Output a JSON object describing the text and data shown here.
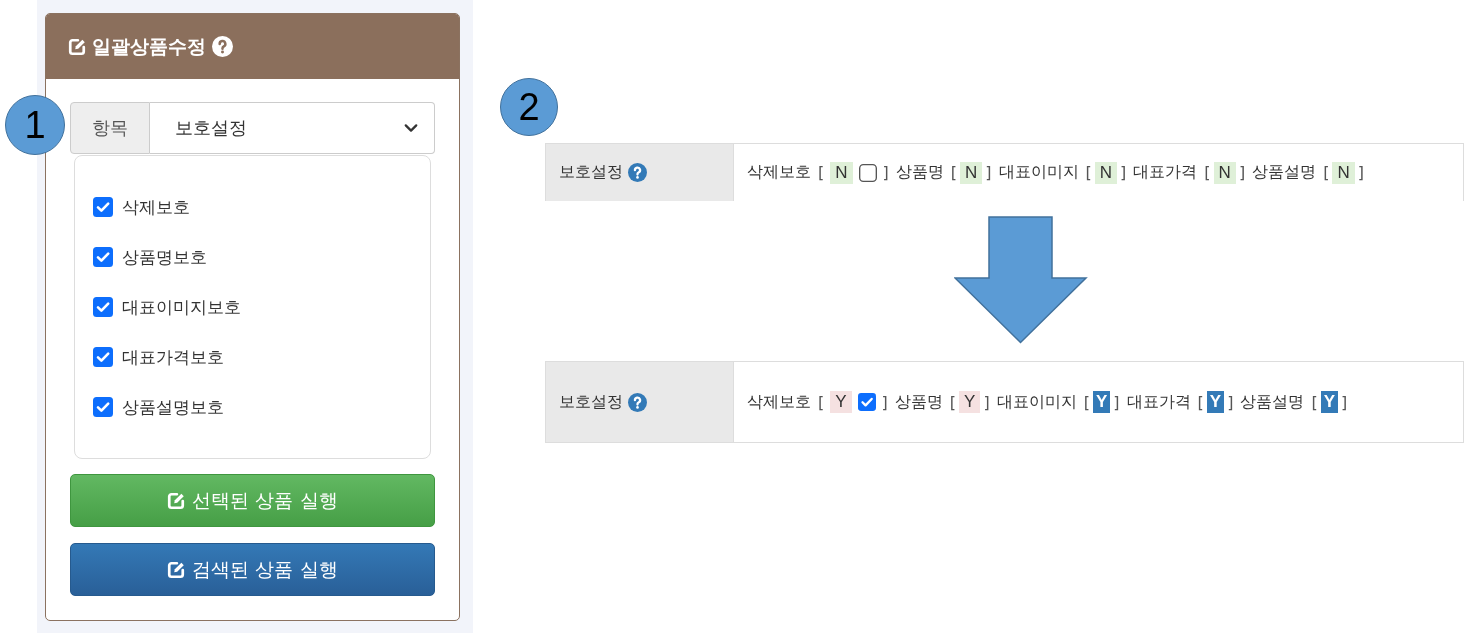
{
  "panel": {
    "title": "일괄상품수정",
    "marker": "1",
    "field": {
      "label": "항목",
      "value": "보호설정"
    },
    "options": [
      {
        "label": "삭제보호",
        "checked": true
      },
      {
        "label": "상품명보호",
        "checked": true
      },
      {
        "label": "대표이미지보호",
        "checked": true
      },
      {
        "label": "대표가격보호",
        "checked": true
      },
      {
        "label": "상품설명보호",
        "checked": true
      }
    ],
    "buttons": [
      {
        "label": "선택된 상품 실행",
        "kind": "success"
      },
      {
        "label": "검색된 상품 실행",
        "kind": "primary"
      }
    ]
  },
  "comparison": {
    "marker": "2",
    "rows": [
      {
        "label": "보호설정",
        "items": [
          {
            "name": "삭제보호",
            "open": "[",
            "value": "N",
            "close": "]",
            "kind": "tag",
            "color": "#dff0d8",
            "checkbox": {
              "checked": false
            }
          },
          {
            "name": "상품명",
            "open": "[",
            "value": "N",
            "close": "]",
            "kind": "tag",
            "color": "#dff0d8"
          },
          {
            "name": "대표이미지",
            "open": "[",
            "value": "N",
            "close": "]",
            "kind": "tag",
            "color": "#dff0d8"
          },
          {
            "name": "대표가격",
            "open": "[",
            "value": "N",
            "close": "]",
            "kind": "tag",
            "color": "#dff0d8"
          },
          {
            "name": "상품설명",
            "open": "[",
            "value": "N",
            "close": "]",
            "kind": "tag",
            "color": "#dff0d8"
          }
        ]
      },
      {
        "label": "보호설정",
        "items": [
          {
            "name": "삭제보호",
            "open": "[",
            "value": "Y",
            "close": "]",
            "kind": "tag",
            "color": "#f5e1e1",
            "checkbox": {
              "checked": true
            }
          },
          {
            "name": "상품명",
            "open": "[",
            "value": "Y",
            "close": "]",
            "kind": "tag",
            "color": "#f5e1e1"
          },
          {
            "name": "대표이미지",
            "open": "[",
            "value": "Y",
            "close": "]",
            "kind": "badge",
            "color": "#337ab7"
          },
          {
            "name": "대표가격",
            "open": "[",
            "value": "Y",
            "close": "]",
            "kind": "badge",
            "color": "#337ab7"
          },
          {
            "name": "상품설명",
            "open": "[",
            "value": "Y",
            "close": "]",
            "kind": "badge",
            "color": "#337ab7"
          }
        ]
      }
    ]
  }
}
